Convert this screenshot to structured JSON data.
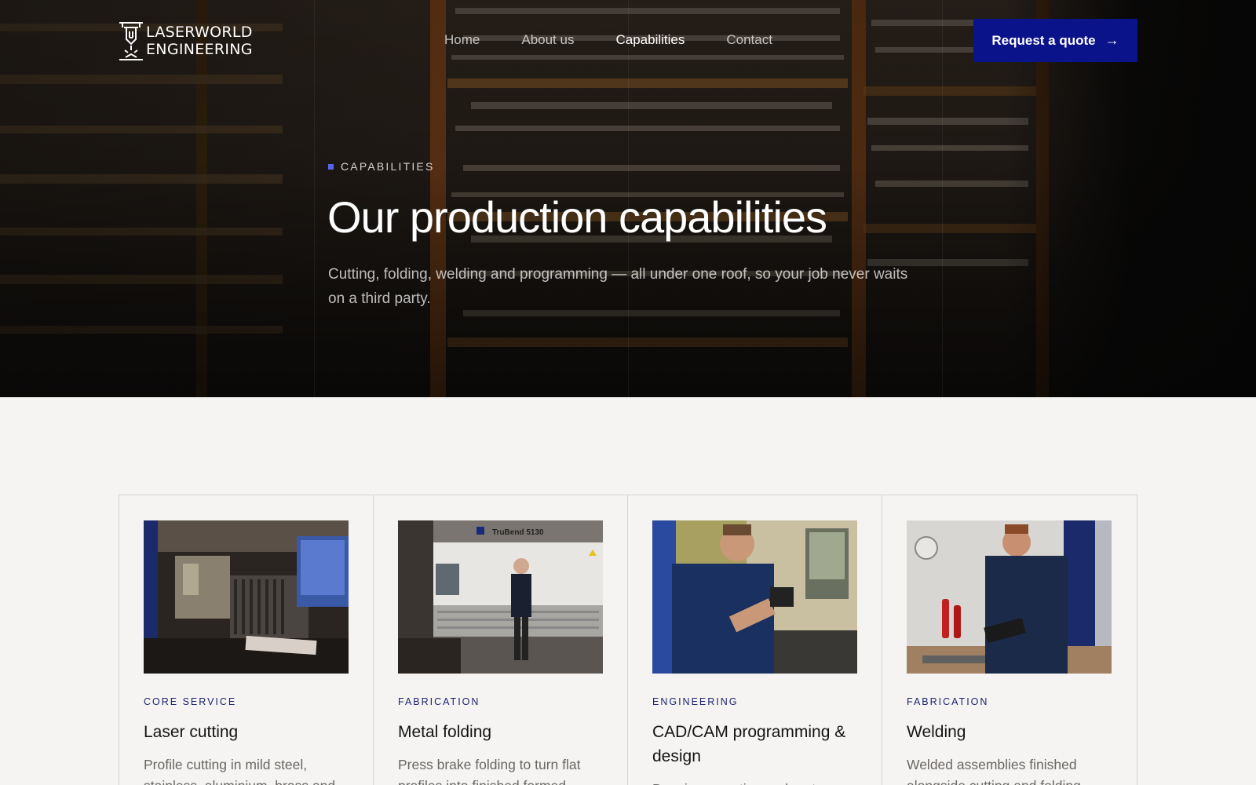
{
  "brand": {
    "line1": "LASERWORLD",
    "line2": "ENGINEERING"
  },
  "nav": {
    "items": [
      {
        "label": "Home",
        "active": false
      },
      {
        "label": "About us",
        "active": false
      },
      {
        "label": "Capabilities",
        "active": true
      },
      {
        "label": "Contact",
        "active": false
      }
    ],
    "cta_label": "Request a quote",
    "cta_icon": "arrow-right-icon"
  },
  "hero": {
    "eyebrow": "CAPABILITIES",
    "title": "Our production capabilities",
    "subtitle": "Cutting, folding, welding and programming — all under one roof, so your job never waits on a third party."
  },
  "cards": [
    {
      "category": "CORE SERVICE",
      "title": "Laser cutting",
      "description": "Profile cutting in mild steel, stainless, aluminium, brass and"
    },
    {
      "category": "FABRICATION",
      "title": "Metal folding",
      "description": "Press brake folding to turn flat profiles into finished formed",
      "machine_label": "TruBend 5130"
    },
    {
      "category": "ENGINEERING",
      "title": "CAD/CAM programming & design",
      "description": "Drawings, nesting and part development"
    },
    {
      "category": "FABRICATION",
      "title": "Welding",
      "description": "Welded assemblies finished alongside cutting and folding"
    }
  ],
  "colors": {
    "accent": "#0b138a",
    "eyebrow_square": "#5a64f0",
    "category_text": "#1c2370",
    "page_bg": "#f5f4f2"
  }
}
